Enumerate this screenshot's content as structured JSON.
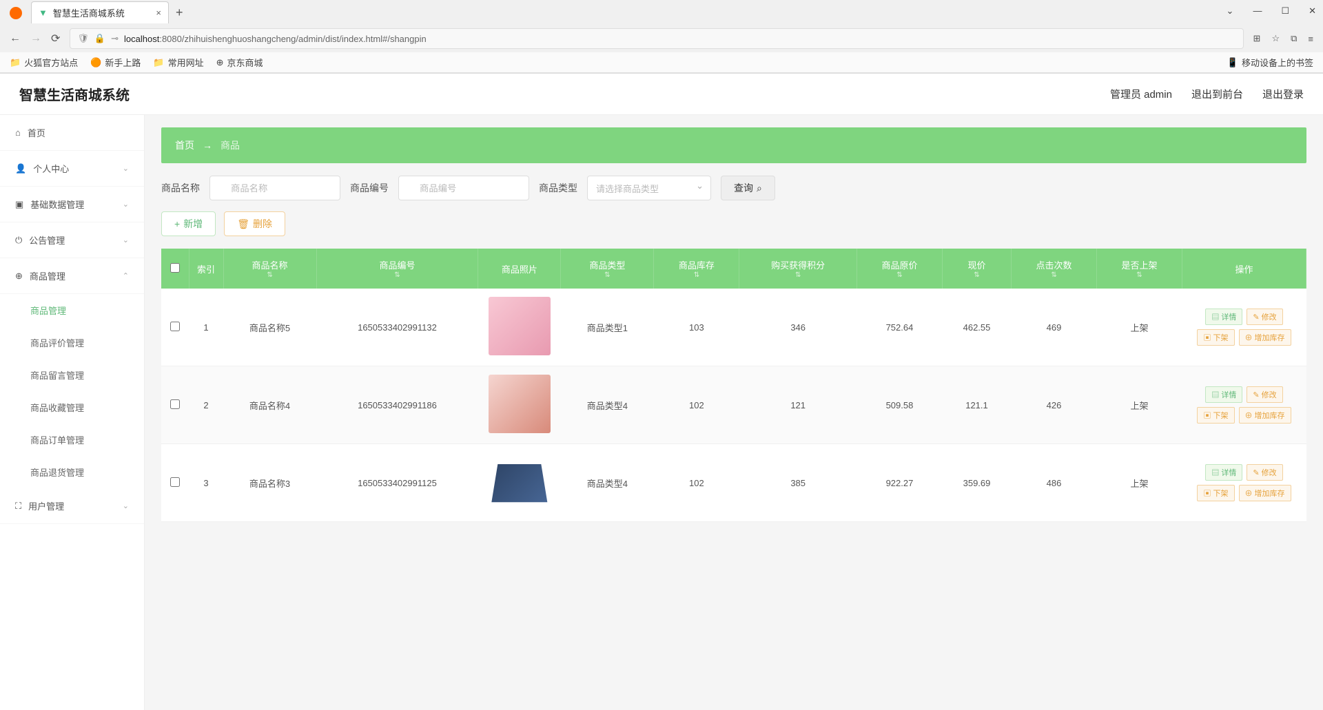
{
  "browser": {
    "tab_title": "智慧生活商城系统",
    "tab_add": "+",
    "tab_close": "×",
    "url_host": "localhost",
    "url_path": ":8080/zhihuishenghuoshangcheng/admin/dist/index.html#/shangpin",
    "win_min": "—",
    "win_max": "☐",
    "win_close": "✕",
    "win_chev": "⌄",
    "nav_back": "←",
    "nav_fwd": "→",
    "nav_reload": "⟳",
    "shield": "🛡",
    "lock": "🔒",
    "key": "⊸",
    "qr": "⊞",
    "star": "☆",
    "ext": "⧉",
    "menu": "≡"
  },
  "bookmarks": {
    "b1": "火狐官方站点",
    "b2": "新手上路",
    "b3": "常用网址",
    "b4": "京东商城",
    "mobile": "移动设备上的书签"
  },
  "header": {
    "title": "智慧生活商城系统",
    "admin": "管理员 admin",
    "to_front": "退出到前台",
    "logout": "退出登录"
  },
  "sidebar": {
    "home": "首页",
    "personal": "个人中心",
    "base_data": "基础数据管理",
    "notice": "公告管理",
    "product": "商品管理",
    "user": "用户管理",
    "subs": {
      "s1": "商品管理",
      "s2": "商品评价管理",
      "s3": "商品留言管理",
      "s4": "商品收藏管理",
      "s5": "商品订单管理",
      "s6": "商品退货管理"
    }
  },
  "breadcrumb": {
    "home": "首页",
    "arrow": "→",
    "current": "商品"
  },
  "search": {
    "name_label": "商品名称",
    "name_placeholder": "商品名称",
    "code_label": "商品编号",
    "code_placeholder": "商品编号",
    "type_label": "商品类型",
    "type_placeholder": "请选择商品类型",
    "query_btn": "查询",
    "add_btn": "新增",
    "del_btn": "删除"
  },
  "table": {
    "headers": {
      "index": "索引",
      "name": "商品名称",
      "code": "商品编号",
      "photo": "商品照片",
      "type": "商品类型",
      "stock": "商品库存",
      "buy": "购买获得积分",
      "original": "商品原价",
      "now": "现价",
      "clicks": "点击次数",
      "onshelf": "是否上架",
      "ops": "操作"
    },
    "rows": [
      {
        "idx": "1",
        "name": "商品名称5",
        "code": "1650533402991132",
        "type": "商品类型1",
        "stock": "103",
        "buy": "346",
        "orig": "752.64",
        "now": "462.55",
        "clicks": "469",
        "shelf": "上架"
      },
      {
        "idx": "2",
        "name": "商品名称4",
        "code": "1650533402991186",
        "type": "商品类型4",
        "stock": "102",
        "buy": "121",
        "orig": "509.58",
        "now": "121.1",
        "clicks": "426",
        "shelf": "上架"
      },
      {
        "idx": "3",
        "name": "商品名称3",
        "code": "1650533402991125",
        "type": "商品类型4",
        "stock": "102",
        "buy": "385",
        "orig": "922.27",
        "now": "359.69",
        "clicks": "486",
        "shelf": "上架"
      }
    ],
    "op_labels": {
      "detail": "详情",
      "edit": "修改",
      "down": "下架",
      "stock": "增加库存"
    }
  }
}
